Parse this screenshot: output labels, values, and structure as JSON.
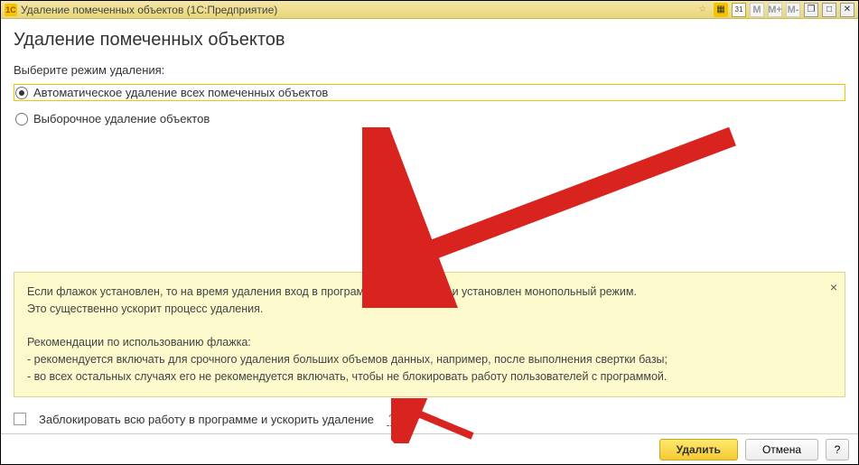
{
  "titlebar": {
    "app_icon": "1C",
    "title": "Удаление помеченных объектов  (1С:Предприятие)",
    "icons": {
      "star": "☆",
      "grid": "▦",
      "cal": "31",
      "m1": "M",
      "m2": "M+",
      "m3": "M-",
      "min": "❐",
      "max": "□",
      "close": "✕"
    }
  },
  "page": {
    "title": "Удаление помеченных объектов",
    "mode_label": "Выберите режим удаления:",
    "radio_auto": "Автоматическое удаление всех помеченных объектов",
    "radio_selective": "Выборочное удаление объектов"
  },
  "hint": {
    "line1": "Если флажок установлен, то на время удаления вход в программу будет закрыт и установлен монопольный режим.",
    "line2": "Это существенно ускорит процесс удаления.",
    "rec_title": "Рекомендации по использованию флажка:",
    "rec1": "- рекомендуется включать для срочного удаления больших объемов данных, например, после выполнения свертки базы;",
    "rec2": "- во всех остальных случаях его не рекомендуется включать, чтобы не блокировать работу пользователей с программой.",
    "close": "×"
  },
  "checkbox": {
    "label": "Заблокировать всю работу в программе и ускорить удаление",
    "help": "?"
  },
  "footer": {
    "delete": "Удалить",
    "cancel": "Отмена",
    "help": "?"
  }
}
